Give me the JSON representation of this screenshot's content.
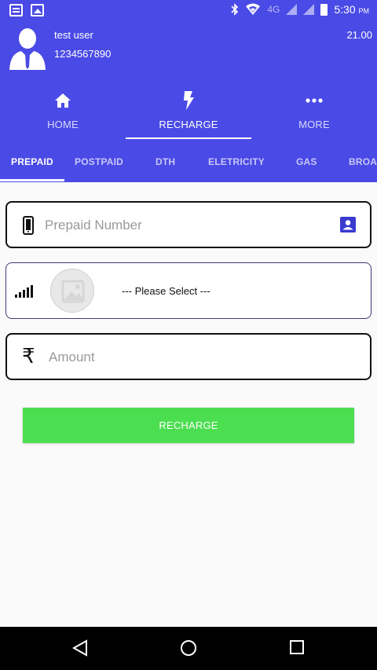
{
  "status_bar": {
    "network": "4G",
    "time": "5:30",
    "time_suffix": "PM"
  },
  "user": {
    "name": "test user",
    "phone": "1234567890",
    "balance": "21.00"
  },
  "nav": {
    "items": [
      {
        "label": "HOME",
        "icon": "home-icon"
      },
      {
        "label": "RECHARGE",
        "icon": "lightning-icon"
      },
      {
        "label": "MORE",
        "icon": "more-dots-icon"
      }
    ],
    "active": "RECHARGE"
  },
  "tabs": {
    "items": [
      "PREPAID",
      "POSTPAID",
      "DTH",
      "ELETRICITY",
      "GAS",
      "BROA"
    ],
    "active": "PREPAID"
  },
  "form": {
    "phone_placeholder": "Prepaid Number",
    "operator_value": "--- Please Select ---",
    "amount_placeholder": "Amount",
    "rupee_symbol": "₹",
    "submit_label": "RECHARGE"
  },
  "colors": {
    "header": "#4a4ae6",
    "button": "#4bde50",
    "contact_icon": "#3a3ad0"
  }
}
